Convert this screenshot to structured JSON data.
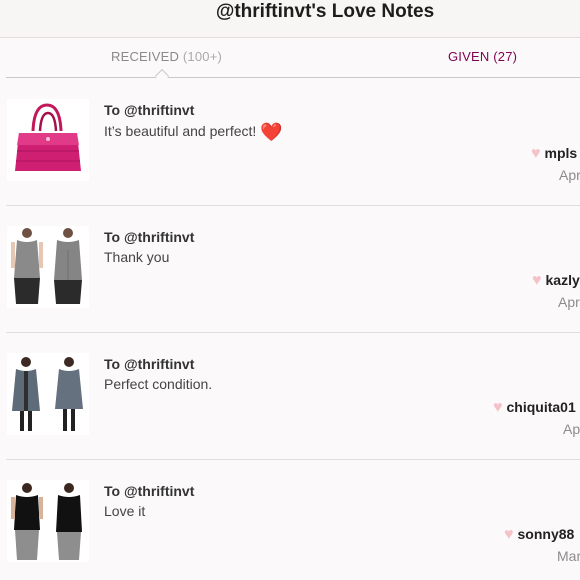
{
  "header": {
    "title": "@thriftinvt's Love Notes"
  },
  "tabs": {
    "received": {
      "label": "RECEIVED",
      "count": "(100+)"
    },
    "given": {
      "label": "GIVEN (27)"
    }
  },
  "notes": [
    {
      "to": "To @thriftinvt",
      "message": "It’s beautiful and perfect!",
      "emoji": "❤️",
      "from": "mpls",
      "date": "Apr",
      "thumb": "pink-handbag"
    },
    {
      "to": "To @thriftinvt",
      "message": "Thank you",
      "from": "kazly",
      "date": "Apr",
      "thumb": "gray-tank-top"
    },
    {
      "to": "To @thriftinvt",
      "message": "Perfect condition.",
      "from": "chiquita01",
      "date": "Ap",
      "thumb": "gray-cardigan"
    },
    {
      "to": "To @thriftinvt",
      "message": "Love it",
      "from": "sonny88",
      "date": "Mar",
      "thumb": "black-top"
    }
  ],
  "colors": {
    "given_tab": "#7f0353",
    "heart_small": "#f4c2c8",
    "divider": "#dedede"
  }
}
